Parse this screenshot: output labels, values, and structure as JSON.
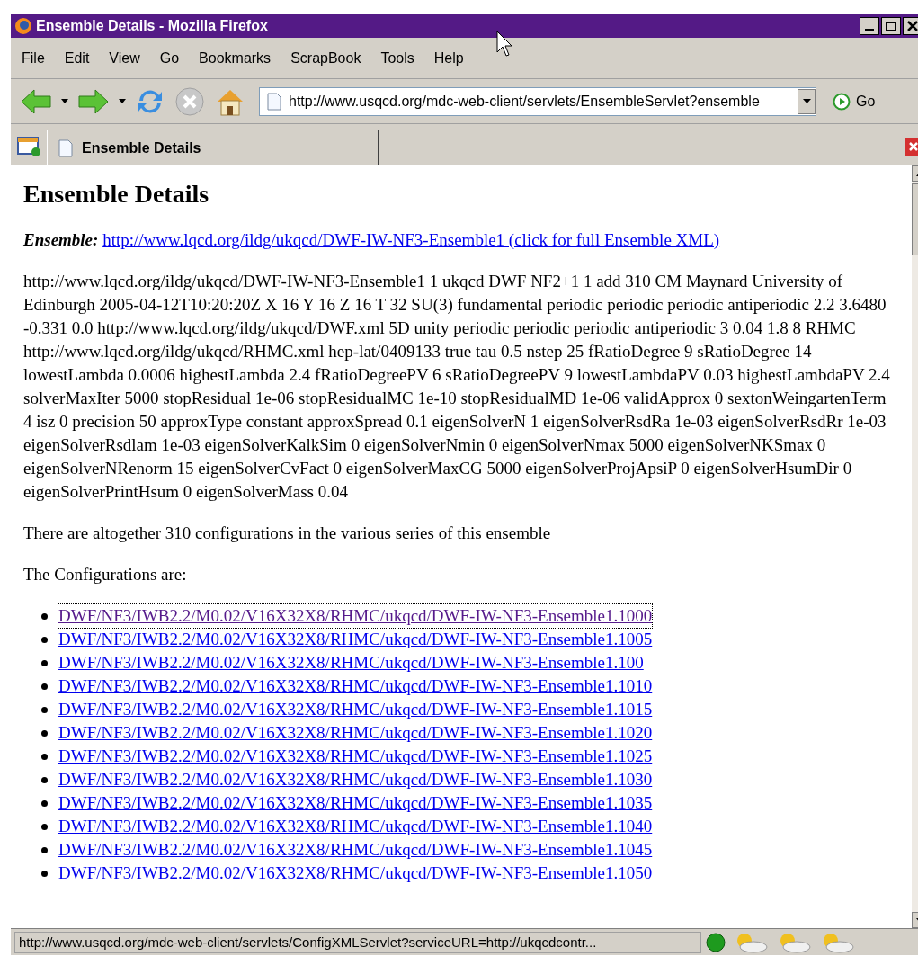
{
  "window": {
    "title": "Ensemble Details - Mozilla Firefox"
  },
  "menu": [
    "File",
    "Edit",
    "View",
    "Go",
    "Bookmarks",
    "ScrapBook",
    "Tools",
    "Help"
  ],
  "address_bar": {
    "value": "http://www.usqcd.org/mdc-web-client/servlets/EnsembleServlet?ensemble",
    "go_label": "Go"
  },
  "tabs": [
    {
      "label": "Ensemble Details",
      "selected": true
    }
  ],
  "page": {
    "heading": "Ensemble Details",
    "ensemble_label": "Ensemble:",
    "ensemble_link": "http://www.lqcd.org/ildg/ukqcd/DWF-IW-NF3-Ensemble1 (click for full Ensemble XML)",
    "details": "http://www.lqcd.org/ildg/ukqcd/DWF-IW-NF3-Ensemble1 1 ukqcd DWF NF2+1 1 add 310 CM Maynard University of Edinburgh 2005-04-12T10:20:20Z X 16 Y 16 Z 16 T 32 SU(3) fundamental periodic periodic periodic antiperiodic 2.2 3.6480 -0.331 0.0 http://www.lqcd.org/ildg/ukqcd/DWF.xml 5D unity periodic periodic periodic antiperiodic 3 0.04 1.8 8 RHMC http://www.lqcd.org/ildg/ukqcd/RHMC.xml hep-lat/0409133 true tau 0.5 nstep 25 fRatioDegree 9 sRatioDegree 14 lowestLambda 0.0006 highestLambda 2.4 fRatioDegreePV 6 sRatioDegreePV 9 lowestLambdaPV 0.03 highestLambdaPV 2.4 solverMaxIter 5000 stopResidual 1e-06 stopResidualMC 1e-10 stopResidualMD 1e-06 validApprox 0 sextonWeingartenTerm 4 isz 0 precision 50 approxType constant approxSpread 0.1 eigenSolverN 1 eigenSolverRsdRa 1e-03 eigenSolverRsdRr 1e-03 eigenSolverRsdlam 1e-03 eigenSolverKalkSim 0 eigenSolverNmin 0 eigenSolverNmax 5000 eigenSolverNKSmax 0 eigenSolverNRenorm 15 eigenSolverCvFact 0 eigenSolverMaxCG 5000 eigenSolverProjApsiP 0 eigenSolverHsumDir 0 eigenSolverPrintHsum 0 eigenSolverMass 0.04",
    "summary": "There are altogether 310 configurations in the various series of this ensemble",
    "list_intro": "The Configurations are:",
    "configurations": [
      {
        "label": "DWF/NF3/IWB2.2/M0.02/V16X32X8/RHMC/ukqcd/DWF-IW-NF3-Ensemble1.1000",
        "visited": true,
        "focused": true
      },
      {
        "label": "DWF/NF3/IWB2.2/M0.02/V16X32X8/RHMC/ukqcd/DWF-IW-NF3-Ensemble1.1005",
        "visited": false,
        "focused": false
      },
      {
        "label": "DWF/NF3/IWB2.2/M0.02/V16X32X8/RHMC/ukqcd/DWF-IW-NF3-Ensemble1.100",
        "visited": false,
        "focused": false
      },
      {
        "label": "DWF/NF3/IWB2.2/M0.02/V16X32X8/RHMC/ukqcd/DWF-IW-NF3-Ensemble1.1010",
        "visited": false,
        "focused": false
      },
      {
        "label": "DWF/NF3/IWB2.2/M0.02/V16X32X8/RHMC/ukqcd/DWF-IW-NF3-Ensemble1.1015",
        "visited": false,
        "focused": false
      },
      {
        "label": "DWF/NF3/IWB2.2/M0.02/V16X32X8/RHMC/ukqcd/DWF-IW-NF3-Ensemble1.1020",
        "visited": false,
        "focused": false
      },
      {
        "label": "DWF/NF3/IWB2.2/M0.02/V16X32X8/RHMC/ukqcd/DWF-IW-NF3-Ensemble1.1025",
        "visited": false,
        "focused": false
      },
      {
        "label": "DWF/NF3/IWB2.2/M0.02/V16X32X8/RHMC/ukqcd/DWF-IW-NF3-Ensemble1.1030",
        "visited": false,
        "focused": false
      },
      {
        "label": "DWF/NF3/IWB2.2/M0.02/V16X32X8/RHMC/ukqcd/DWF-IW-NF3-Ensemble1.1035",
        "visited": false,
        "focused": false
      },
      {
        "label": "DWF/NF3/IWB2.2/M0.02/V16X32X8/RHMC/ukqcd/DWF-IW-NF3-Ensemble1.1040",
        "visited": false,
        "focused": false
      },
      {
        "label": "DWF/NF3/IWB2.2/M0.02/V16X32X8/RHMC/ukqcd/DWF-IW-NF3-Ensemble1.1045",
        "visited": false,
        "focused": false
      },
      {
        "label": "DWF/NF3/IWB2.2/M0.02/V16X32X8/RHMC/ukqcd/DWF-IW-NF3-Ensemble1.1050",
        "visited": false,
        "focused": false
      }
    ]
  },
  "status_bar": {
    "text": "http://www.usqcd.org/mdc-web-client/servlets/ConfigXMLServlet?serviceURL=http://ukqcdcontr..."
  }
}
